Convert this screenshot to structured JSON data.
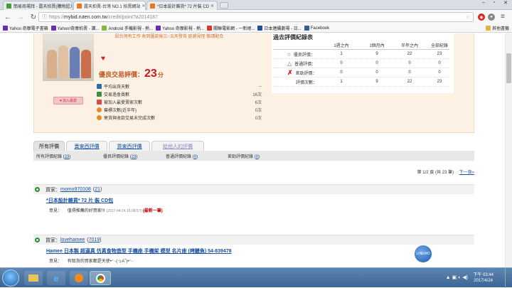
{
  "browser": {
    "tabs": [
      {
        "label": "簡易商場拜 - 露天拍賣(購物超方便)",
        "favicon_color": "#4a9b3f"
      },
      {
        "label": "露天拍賣-台灣 NO.1 拍賣網站",
        "favicon_color": "#e8791d"
      },
      {
        "label": "*日本設計雜貨* 72 片裝 CD",
        "favicon_color": "#e8791d"
      }
    ],
    "url_host": "mybid.ruten.com.tw",
    "url_path": "/credit/point?a2014187",
    "url_prefix": "https://"
  },
  "bookmarks": [
    {
      "label": "Yahoo 奇摩電子書箱",
      "icon_color": "#6b2bb3"
    },
    {
      "label": "Yahoo!奇摩拍賣 - 讚...",
      "icon_color": "#6b2bb3"
    },
    {
      "label": "Android 手機影視 - 熱...",
      "icon_color": "#8ab43c"
    },
    {
      "label": "Yahoo 奇摩影視 - 熱...",
      "icon_color": "#6b2bb3"
    },
    {
      "label": "關聯電影網 - 一新絕...",
      "icon_color": "#d33"
    },
    {
      "label": "日本連續劇場 - 日...",
      "icon_color": "#1c4f9c"
    },
    {
      "label": "Facebook",
      "icon_color": "#3b5998"
    }
  ],
  "bookmarks_other": "其他書籤",
  "notice": "因台灣有工作 收到匯款後三~五天發貨 延遲見怪 敬請配合",
  "add_button": "加入最愛",
  "score": {
    "label": "優良交易評價：",
    "value": "23",
    "unit": "分"
  },
  "stats": [
    {
      "label": "平均出貨天數",
      "value": "--",
      "icon_color": "#2b6cb0"
    },
    {
      "label": "交易過會員數",
      "value": "16次",
      "icon_color": "#3a8f3a"
    },
    {
      "label": "被加入最愛賣家次數",
      "value": "6次",
      "icon_color": "#d94a4a"
    },
    {
      "label": "棄標次數(近半年)",
      "value": "0次",
      "icon_color": "#e88a2a"
    },
    {
      "label": "寄貨與收款交易未完成次數",
      "value": "0次",
      "icon_color": "#e88a2a"
    }
  ],
  "past": {
    "title": "過去評價紀錄表",
    "headers": [
      "1週之內",
      "1個月內",
      "半年之內",
      "全部紀錄"
    ],
    "rows": [
      {
        "label": "優良評價：",
        "icon": "good-circle-icon",
        "icon_color": "#2d8a2d",
        "values": [
          "1",
          "9",
          "22",
          "23"
        ]
      },
      {
        "label": "普通評價：",
        "icon": "neutral-triangle-icon",
        "icon_color": "#2a6bc2",
        "values": [
          "0",
          "0",
          "0",
          "0"
        ]
      },
      {
        "label": "差勁評價：",
        "icon": "bad-x-icon",
        "icon_color": "#d11",
        "values": [
          "0",
          "0",
          "0",
          "0"
        ]
      },
      {
        "label": "評價次數：",
        "icon": "",
        "icon_color": "",
        "values": [
          "1",
          "9",
          "22",
          "23"
        ]
      }
    ]
  },
  "feedback_tabs": [
    "所有評價",
    "賣東西評價",
    "買東西評價",
    "給他人的評價"
  ],
  "sub_tabs": [
    {
      "label": "所有評價紀錄",
      "count": "23"
    },
    {
      "label": "優良評價紀錄",
      "count": "23"
    },
    {
      "label": "普通評價紀錄",
      "count": "0"
    },
    {
      "label": "差勁評價紀錄",
      "count": "0"
    }
  ],
  "pagination": {
    "text": "第 1/2 頁 (共 23 筆)",
    "next": "下一頁»"
  },
  "entries": [
    {
      "buyer_label": "買家：",
      "buyer": "momo970108",
      "buyer_score": "21",
      "item": "*日本設計雜貨* 72 片 裝 CD包",
      "comment_label": "意見：",
      "comment": "值得推薦的好買家!!!",
      "date": "(2017-04-24 15:08:57)",
      "latest": "(最新一筆)"
    },
    {
      "buyer_label": "買家：",
      "buyer": "lovehamee",
      "buyer_score": "7019",
      "item": "Hamee 日本製 超逼真 仿真食物造型 手機座 手機架 模型 名片座 (烤鰻魚) 54-839478",
      "comment_label": "意見：",
      "comment": "有取貨的買家都是天使•ᐟ‧˖(っA˘)•ᐟ‧˖",
      "date": "",
      "latest": ""
    }
  ],
  "float_badge": "LINEMO",
  "taskbar": {
    "time": "下午 03:44",
    "date": "2017/4/24"
  }
}
